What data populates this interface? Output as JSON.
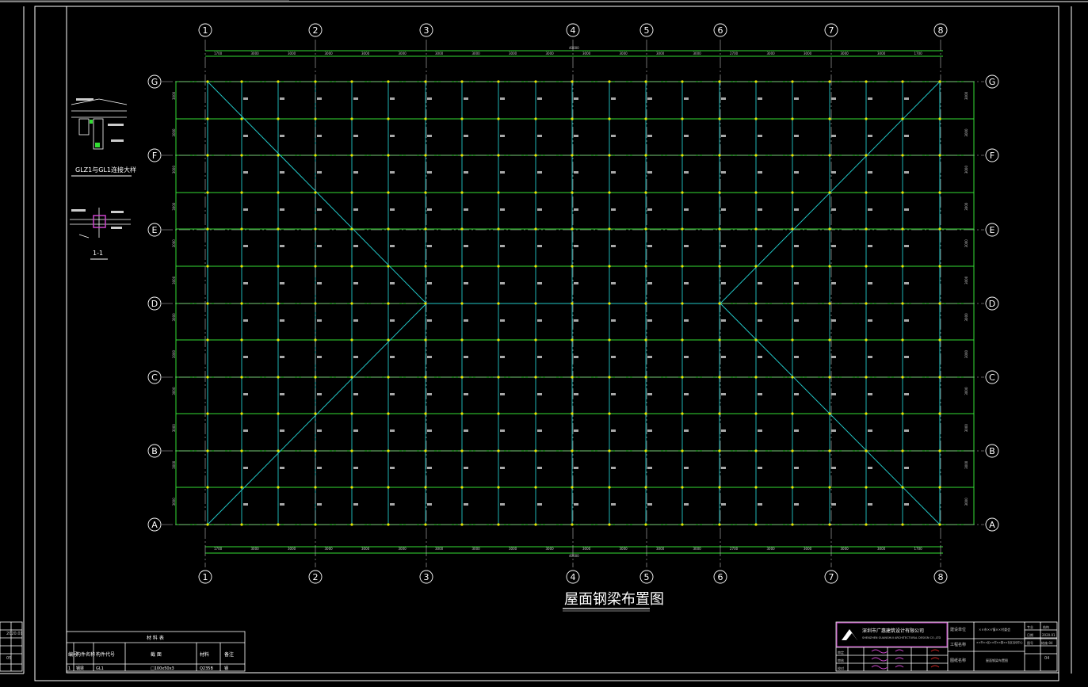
{
  "drawing": {
    "title": "屋面钢梁布置图",
    "grid_columns": [
      "1",
      "2",
      "3",
      "4",
      "5",
      "6",
      "7",
      "8"
    ],
    "grid_rows": [
      "G",
      "F",
      "E",
      "D",
      "C",
      "B",
      "A"
    ],
    "overall_dimension": "40000",
    "bay_dimensions_top": [
      "1700",
      "3000",
      "3000",
      "3000",
      "3000",
      "3000",
      "3000",
      "3000",
      "3000",
      "3000",
      "3000",
      "3000",
      "3000",
      "3000",
      "2700",
      "3000",
      "3000",
      "3000",
      "3000",
      "1700"
    ],
    "row_dimensions": [
      "3000",
      "3000",
      "3000",
      "3000",
      "3000",
      "3000",
      "3000",
      "3000",
      "3000",
      "3000",
      "3000",
      "3000"
    ]
  },
  "detail_1": {
    "title": "GLZ1与GL1连接大样"
  },
  "detail_2": {
    "title": "1-1"
  },
  "material_table": {
    "title": "材 料 表",
    "headers": [
      "编号",
      "构件名称",
      "构件代号",
      "截 面",
      "材料",
      "备注"
    ],
    "rows": [
      [
        "1",
        "钢梁",
        "GL1",
        "□100x50x3",
        "Q235B",
        "钢"
      ]
    ]
  },
  "title_block": {
    "company": "深圳市广惠建筑设计有限公司",
    "company_en": "SHENZHEN GUANGHUI ARCHITECTURAL DESIGN CO.,LTD",
    "project_label": "建设单位",
    "project_value": "××市××镇××村委会",
    "sub_project_label": "工程名称",
    "sub_project_value": "××市××区××村××镇××社区活动中心",
    "drawing_name_label": "图纸名称",
    "drawing_name_value": "屋面钢梁布置图",
    "roles": [
      "审定",
      "审核",
      "校对"
    ],
    "right_labels": [
      "专业",
      "日期",
      "图号"
    ],
    "right_values": [
      "结构",
      "2020.01",
      "结施-04"
    ],
    "sheet_no": "04"
  },
  "left_strip": {
    "date": "2020.01",
    "sheet": "05"
  },
  "colors": {
    "background": "#000000",
    "frame": "#ffffff",
    "grid_green": "#33dd33",
    "beam_cyan": "#22c8c8",
    "node_yellow": "#e6e600",
    "axis_dash": "#bbbbbb",
    "magenta": "#cc44cc"
  }
}
